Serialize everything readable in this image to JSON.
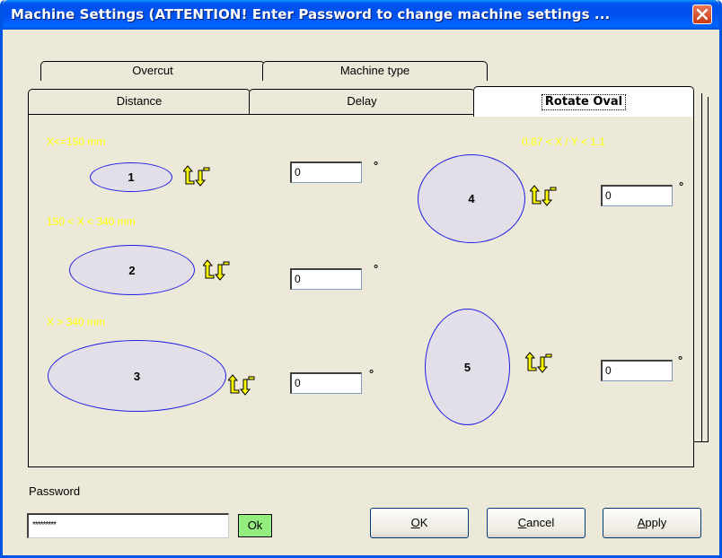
{
  "window": {
    "title": "Machine Settings (ATTENTION! Enter Password to change machine settings ..."
  },
  "tabs": {
    "back_row": [
      {
        "label": "Overcut"
      },
      {
        "label": "Machine type"
      }
    ],
    "front_row": [
      {
        "label": "Distance"
      },
      {
        "label": "Delay"
      },
      {
        "label": "Rotate Oval",
        "active": true
      }
    ]
  },
  "rotate_oval": {
    "range_labels": {
      "small": "X<=150 mm",
      "medium": "150 < X < 340 mm",
      "large": "X > 340 mm",
      "ratio": "0.87 < X / Y < 1.1"
    },
    "ovals": [
      {
        "number": "1",
        "value": "0",
        "unit": "°"
      },
      {
        "number": "2",
        "value": "0",
        "unit": "°"
      },
      {
        "number": "3",
        "value": "0",
        "unit": "°"
      },
      {
        "number": "4",
        "value": "0",
        "unit": "°"
      },
      {
        "number": "5",
        "value": "0",
        "unit": "°"
      }
    ],
    "label_color": "#ffff00",
    "oval_border_color": "#1e1ee6",
    "rotate_icon": "rotate-arrows-icon"
  },
  "password": {
    "label": "Password",
    "value": "*********",
    "ok_label": "Ok"
  },
  "buttons": {
    "ok": {
      "mnemonic": "O",
      "rest": "K"
    },
    "cancel": {
      "mnemonic": "C",
      "rest": "ancel"
    },
    "apply": {
      "mnemonic": "A",
      "rest": "pply"
    }
  }
}
